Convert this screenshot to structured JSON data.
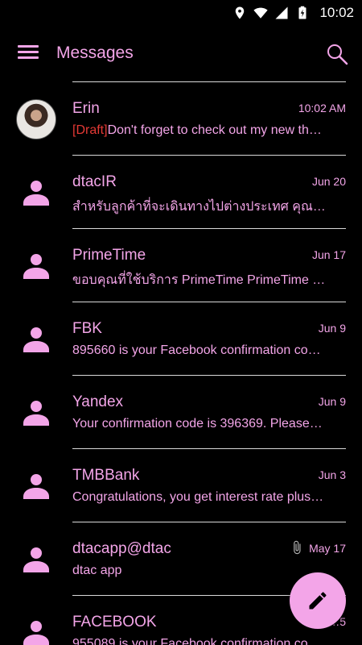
{
  "status_bar": {
    "time": "10:02",
    "icons": [
      "location-icon",
      "wifi-icon",
      "signal-icon",
      "battery-charging-icon"
    ]
  },
  "toolbar": {
    "title": "Messages",
    "menu_icon": "hamburger-menu-icon",
    "search_icon": "search-icon"
  },
  "colors": {
    "background": "#000000",
    "accent": "#f3a5e8",
    "draft": "#e53935",
    "divider": "#d9d9d9"
  },
  "conversations": [
    {
      "name": "Erin",
      "date": "10:02 AM",
      "draft_label": "[Draft]",
      "snippet": "Don't forget to check out my new th…",
      "avatar": "photo"
    },
    {
      "name": "dtacIR",
      "date": "Jun 20",
      "snippet": "สำหรับลูกค้าที่จะเดินทางไปต่างประเทศ คุณ…",
      "avatar": "person-icon"
    },
    {
      "name": "PrimeTime",
      "date": "Jun 17",
      "snippet": "ขอบคุณที่ใช้บริการ PrimeTime PrimeTime …",
      "avatar": "person-icon"
    },
    {
      "name": "FBK",
      "date": "Jun 9",
      "snippet": "895660 is your Facebook confirmation co…",
      "avatar": "person-icon"
    },
    {
      "name": "Yandex",
      "date": "Jun 9",
      "snippet": "Your confirmation code is 396369. Please…",
      "avatar": "person-icon"
    },
    {
      "name": "TMBBank",
      "date": "Jun 3",
      "snippet": "Congratulations, you get interest rate plus…",
      "avatar": "person-icon"
    },
    {
      "name": "dtacapp@dtac",
      "date": "May 17",
      "snippet": "dtac app",
      "avatar": "person-icon",
      "attachment_icon": "paperclip-icon"
    },
    {
      "name": "FACEBOOK",
      "date": "…5",
      "snippet": "955089 is your Facebook confirmation co…",
      "avatar": "person-icon"
    }
  ],
  "fab": {
    "icon": "pencil-icon"
  }
}
